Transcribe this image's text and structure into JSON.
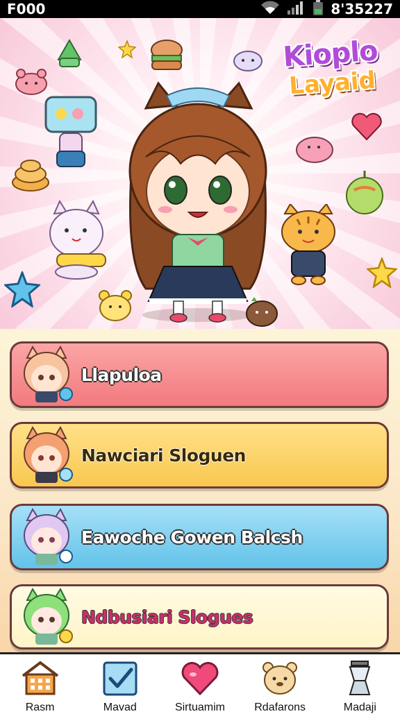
{
  "status_bar": {
    "left_text": "F000",
    "right_text": "8'35227",
    "icons": [
      "wifi-icon",
      "signal-icon",
      "battery-icon"
    ]
  },
  "logo": {
    "line1": "Kioplo",
    "line2": "Layaid"
  },
  "menu": {
    "items": [
      {
        "label": "Llapuloa",
        "color": "#f27a7e",
        "avatar": "catgirl-avatar-peach"
      },
      {
        "label": "Nawciari Sloguen",
        "color": "#f9c74f",
        "avatar": "catgirl-avatar-orange"
      },
      {
        "label": "Eawoche Gowen Balcsh",
        "color": "#62c3ea",
        "avatar": "catgirl-avatar-lavender"
      },
      {
        "label": "Ndbusiari Slogues",
        "color": "#fff4c8",
        "avatar": "catgirl-avatar-green"
      }
    ]
  },
  "nav": {
    "items": [
      {
        "label": "Rasm",
        "icon": "house-icon"
      },
      {
        "label": "Mavad",
        "icon": "checkbox-icon"
      },
      {
        "label": "Sirtuamim",
        "icon": "heart-icon"
      },
      {
        "label": "Rdafarons",
        "icon": "bear-icon"
      },
      {
        "label": "Madaji",
        "icon": "cup-icon"
      }
    ]
  }
}
